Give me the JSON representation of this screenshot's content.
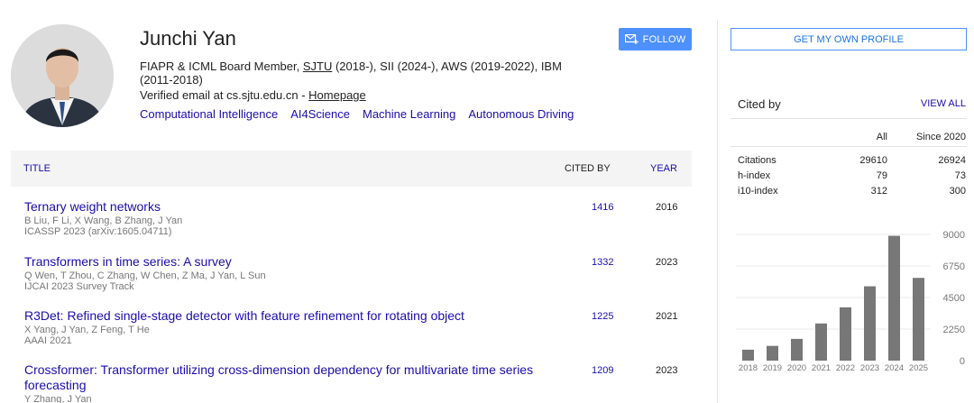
{
  "profile": {
    "name": "Junchi Yan",
    "affil_prefix": "FIAPR & ICML Board Member, ",
    "affil_link": "SJTU",
    "affil_suffix": " (2018-), SII (2024-), AWS (2019-2022), IBM (2011-2018)",
    "email_text": "Verified email at cs.sjtu.edu.cn - ",
    "homepage": "Homepage",
    "interests": [
      "Computational Intelligence",
      "AI4Science",
      "Machine Learning",
      "Autonomous Driving"
    ]
  },
  "buttons": {
    "follow": "FOLLOW",
    "own_profile": "GET MY OWN PROFILE"
  },
  "table": {
    "col_title": "TITLE",
    "col_cited": "CITED BY",
    "col_year": "YEAR",
    "rows": [
      {
        "title": "Ternary weight networks",
        "authors": "B Liu, F Li, X Wang, B Zhang, J Yan",
        "venue": "ICASSP 2023 (arXiv:1605.04711)",
        "cited": "1416",
        "year": "2016"
      },
      {
        "title": "Transformers in time series: A survey",
        "authors": "Q Wen, T Zhou, C Zhang, W Chen, Z Ma, J Yan, L Sun",
        "venue": "IJCAI 2023 Survey Track",
        "cited": "1332",
        "year": "2023"
      },
      {
        "title": "R3Det: Refined single-stage detector with feature refinement for rotating object",
        "authors": "X Yang, J Yan, Z Feng, T He",
        "venue": "AAAI 2021",
        "cited": "1225",
        "year": "2021"
      },
      {
        "title": "Crossformer: Transformer utilizing cross-dimension dependency for multivariate time series forecasting",
        "authors": "Y Zhang, J Yan",
        "venue": "",
        "cited": "1209",
        "year": "2023"
      }
    ]
  },
  "cited_by": {
    "heading": "Cited by",
    "view_all": "VIEW ALL",
    "col_all": "All",
    "col_since": "Since 2020",
    "metrics": [
      {
        "label": "Citations",
        "all": "29610",
        "since": "26924"
      },
      {
        "label": "h-index",
        "all": "79",
        "since": "73"
      },
      {
        "label": "i10-index",
        "all": "312",
        "since": "300"
      }
    ]
  },
  "chart_data": {
    "type": "bar",
    "categories": [
      "2018",
      "2019",
      "2020",
      "2021",
      "2022",
      "2023",
      "2024",
      "2025"
    ],
    "values": [
      780,
      1050,
      1550,
      2650,
      3800,
      5300,
      8900,
      5900
    ],
    "ylim": [
      0,
      9000
    ],
    "yticks": [
      "9000",
      "6750",
      "4500",
      "2250",
      "0"
    ],
    "bar_color": "#777777"
  }
}
